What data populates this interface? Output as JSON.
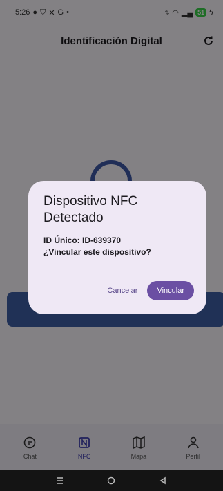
{
  "statusbar": {
    "time": "5:26",
    "icons": [
      "chat-icon",
      "shield-icon",
      "x-icon",
      "G",
      "•"
    ],
    "battery": "51"
  },
  "appbar": {
    "title": "Identificación Digital"
  },
  "dialog": {
    "title": "Dispositivo NFC Detectado",
    "id_line": "ID Único: ID-639370",
    "question": "¿Vincular este dispositivo?",
    "cancel": "Cancelar",
    "confirm": "Vincular"
  },
  "nav": {
    "items": [
      {
        "label": "Chat",
        "icon": "chat-bubble-icon"
      },
      {
        "label": "NFC",
        "icon": "nfc-icon",
        "active": true
      },
      {
        "label": "Mapa",
        "icon": "map-icon"
      },
      {
        "label": "Perfil",
        "icon": "person-icon"
      }
    ]
  },
  "colors": {
    "accent": "#6b4fa3",
    "nfc_blue": "#3f59a8",
    "dialog_bg": "#efe8f5"
  }
}
